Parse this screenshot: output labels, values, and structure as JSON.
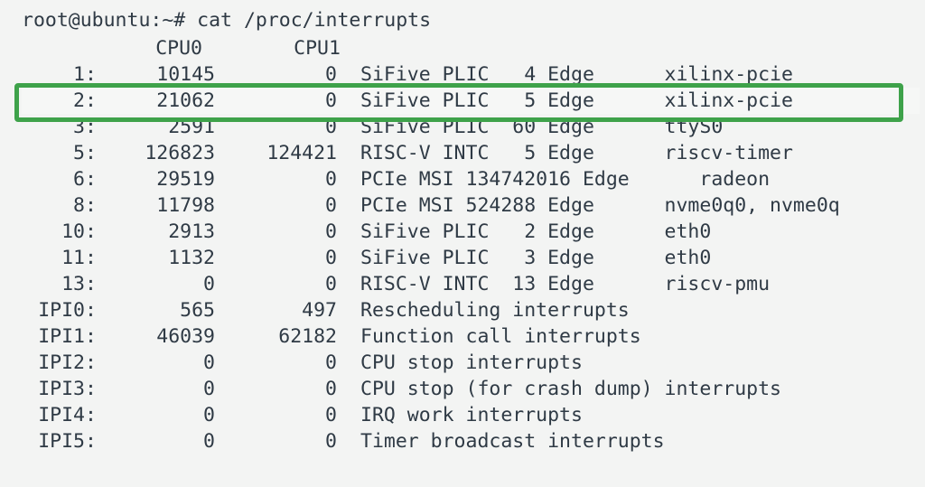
{
  "prompt": "root@ubuntu:~# cat /proc/interrupts",
  "header": {
    "cpu0": "CPU0",
    "cpu1": "CPU1"
  },
  "highlight_color": "#3ea24a",
  "rows": [
    {
      "irq": "1",
      "cpu0": "10145",
      "cpu1": "0",
      "rest": "SiFive PLIC   4 Edge      xilinx-pcie"
    },
    {
      "irq": "2",
      "cpu0": "21062",
      "cpu1": "0",
      "rest": "SiFive PLIC   5 Edge      xilinx-pcie",
      "highlight": true
    },
    {
      "irq": "3",
      "cpu0": "2591",
      "cpu1": "0",
      "rest": "SiFive PLIC  60 Edge      ttyS0"
    },
    {
      "irq": "5",
      "cpu0": "126823",
      "cpu1": "124421",
      "rest": "RISC-V INTC   5 Edge      riscv-timer"
    },
    {
      "irq": "6",
      "cpu0": "29519",
      "cpu1": "0",
      "rest": "PCIe MSI 134742016 Edge      radeon"
    },
    {
      "irq": "8",
      "cpu0": "11798",
      "cpu1": "0",
      "rest": "PCIe MSI 524288 Edge      nvme0q0, nvme0q"
    },
    {
      "irq": "10",
      "cpu0": "2913",
      "cpu1": "0",
      "rest": "SiFive PLIC   2 Edge      eth0"
    },
    {
      "irq": "11",
      "cpu0": "1132",
      "cpu1": "0",
      "rest": "SiFive PLIC   3 Edge      eth0"
    },
    {
      "irq": "13",
      "cpu0": "0",
      "cpu1": "0",
      "rest": "RISC-V INTC  13 Edge      riscv-pmu"
    },
    {
      "irq": "IPI0",
      "cpu0": "565",
      "cpu1": "497",
      "rest": "Rescheduling interrupts"
    },
    {
      "irq": "IPI1",
      "cpu0": "46039",
      "cpu1": "62182",
      "rest": "Function call interrupts"
    },
    {
      "irq": "IPI2",
      "cpu0": "0",
      "cpu1": "0",
      "rest": "CPU stop interrupts"
    },
    {
      "irq": "IPI3",
      "cpu0": "0",
      "cpu1": "0",
      "rest": "CPU stop (for crash dump) interrupts"
    },
    {
      "irq": "IPI4",
      "cpu0": "0",
      "cpu1": "0",
      "rest": "IRQ work interrupts"
    },
    {
      "irq": "IPI5",
      "cpu0": "0",
      "cpu1": "0",
      "rest": "Timer broadcast interrupts"
    }
  ]
}
